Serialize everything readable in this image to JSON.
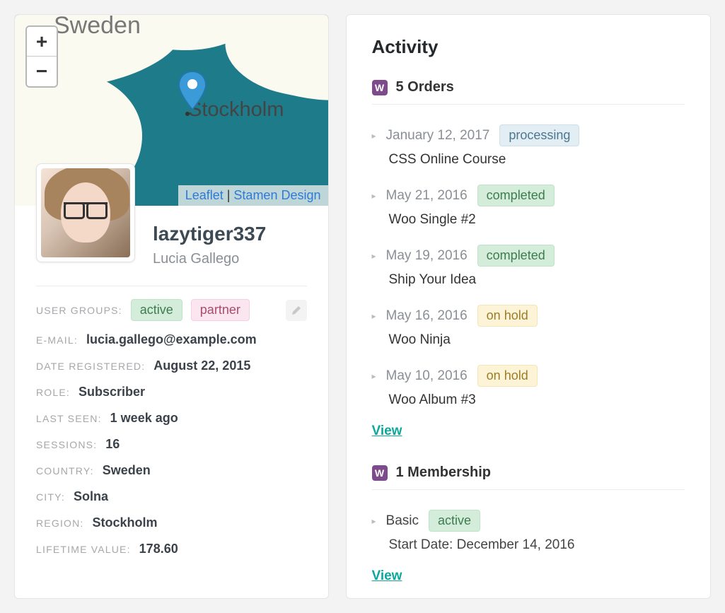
{
  "map": {
    "country_label": "Sweden",
    "city_label": "Stockholm",
    "attribution_leaflet": "Leaflet",
    "attribution_separator": " | ",
    "attribution_stamen": "Stamen Design"
  },
  "profile": {
    "username": "lazytiger337",
    "fullname": "Lucia Gallego"
  },
  "fields": {
    "user_groups_label": "USER GROUPS:",
    "tags": [
      "active",
      "partner"
    ],
    "email_label": "E-MAIL:",
    "email": "lucia.gallego@example.com",
    "date_registered_label": "DATE REGISTERED:",
    "date_registered": "August 22, 2015",
    "role_label": "ROLE:",
    "role": "Subscriber",
    "last_seen_label": "LAST SEEN:",
    "last_seen": "1 week ago",
    "sessions_label": "SESSIONS:",
    "sessions": "16",
    "country_label": "COUNTRY:",
    "country": "Sweden",
    "city_label": "CITY:",
    "city": "Solna",
    "region_label": "REGION:",
    "region": "Stockholm",
    "lifetime_value_label": "LIFETIME VALUE:",
    "lifetime_value": "178.60"
  },
  "activity": {
    "heading": "Activity",
    "orders_heading": "5 Orders",
    "orders": [
      {
        "date": "January 12, 2017",
        "status": "processing",
        "status_color": "blue",
        "title": "CSS Online Course"
      },
      {
        "date": "May 21, 2016",
        "status": "completed",
        "status_color": "green",
        "title": "Woo Single #2"
      },
      {
        "date": "May 19, 2016",
        "status": "completed",
        "status_color": "green",
        "title": "Ship Your Idea"
      },
      {
        "date": "May 16, 2016",
        "status": "on hold",
        "status_color": "yellow",
        "title": "Woo Ninja"
      },
      {
        "date": "May 10, 2016",
        "status": "on hold",
        "status_color": "yellow",
        "title": "Woo Album #3"
      }
    ],
    "view_label": "View",
    "memberships_heading": "1 Membership",
    "memberships": [
      {
        "name": "Basic",
        "status": "active",
        "status_color": "green",
        "start_label": "Start Date: ",
        "start": "December 14, 2016"
      }
    ]
  }
}
